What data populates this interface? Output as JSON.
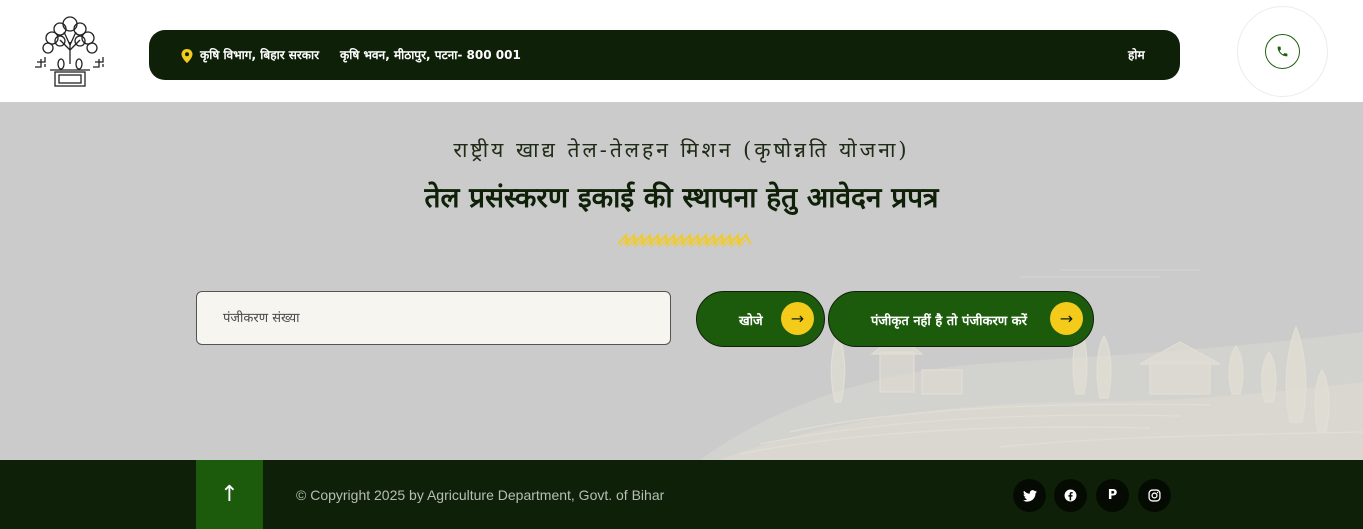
{
  "header": {
    "logo_icon": "bihar-emblem-icon",
    "topbar": {
      "location_icon": "map-pin-icon",
      "department": "कृषि विभाग, बिहार सरकार",
      "address": "कृषि भवन, मीठापुर, पटना- 800 001",
      "home_link": "होम"
    },
    "phone_icon": "phone-icon"
  },
  "hero": {
    "scheme_name": "राष्ट्रीय खाद्य तेल-तेलहन मिशन (कृषोन्नति योजना)",
    "form_title": "तेल प्रसंस्करण इकाई की स्थापना हेतु आवेदन प्रपत्र",
    "registration_input": {
      "placeholder": "पंजीकरण संख्या",
      "value": ""
    },
    "search_button": {
      "label": "खोजे",
      "icon": "arrow-right-icon",
      "arrow": "→"
    },
    "register_button": {
      "label": "पंजीकृत नहीं है तो पंजीकरण करें",
      "icon": "arrow-right-icon",
      "arrow": "→"
    }
  },
  "footer": {
    "to_top_icon": "arrow-up-icon",
    "to_top_glyph": "↑",
    "copyright": "© Copyright 2025 by Agriculture Department, Govt. of Bihar",
    "social": [
      {
        "icon": "twitter-icon"
      },
      {
        "icon": "facebook-icon"
      },
      {
        "icon": "pinterest-icon",
        "glyph": "P"
      },
      {
        "icon": "instagram-icon"
      }
    ]
  },
  "colors": {
    "dark_green": "#0f2009",
    "button_green": "#1d5b0c",
    "accent_yellow": "#f5cb1b",
    "hero_bg": "#cbcbcb"
  }
}
